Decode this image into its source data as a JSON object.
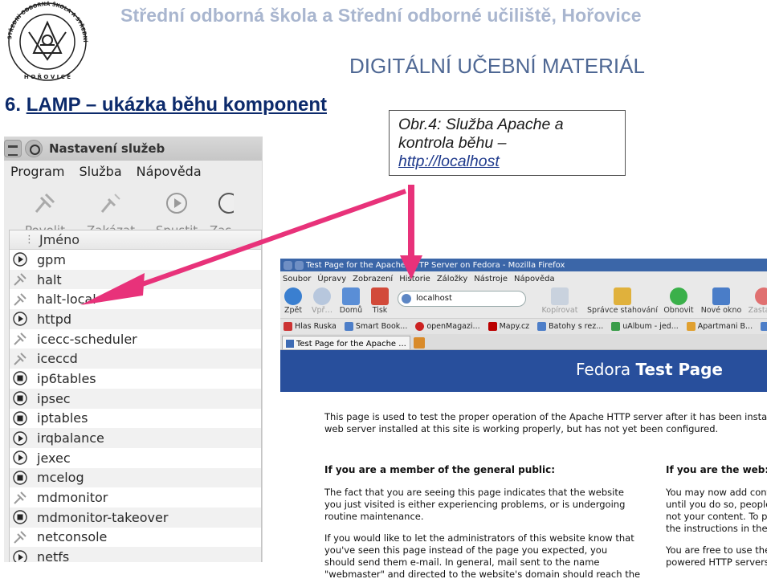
{
  "header": {
    "school_name": "Střední odborná škola a Střední odborné učiliště, Hořovice",
    "material_title": "DIGITÁLNÍ UČEBNÍ MATERIÁL",
    "logo_ring_text": "STŘEDNÍ ODBORNÁ ŠKOLA A STŘEDNÍ ODBORNÉ UČILIŠTĚ",
    "logo_city": "H O Ř O V I C E"
  },
  "slide": {
    "number": "6.",
    "title": "LAMP – ukázka běhu komponent"
  },
  "caption": {
    "line1": "Obr.4: Služba Apache a",
    "line2": "kontrola běhu –",
    "url": "http://localhost"
  },
  "service_manager": {
    "window_title": "Nastavení služeb",
    "menu": [
      "Program",
      "Služba",
      "Nápověda"
    ],
    "toolbar": [
      "Povolit",
      "Zakázat",
      "Spustit",
      "Zas"
    ],
    "column_header": "Jméno",
    "services": [
      {
        "name": "gpm",
        "state": "run"
      },
      {
        "name": "halt",
        "state": "off"
      },
      {
        "name": "halt-local",
        "state": "off"
      },
      {
        "name": "httpd",
        "state": "run"
      },
      {
        "name": "icecc-scheduler",
        "state": "off"
      },
      {
        "name": "iceccd",
        "state": "off"
      },
      {
        "name": "ip6tables",
        "state": "stop"
      },
      {
        "name": "ipsec",
        "state": "stop"
      },
      {
        "name": "iptables",
        "state": "stop"
      },
      {
        "name": "irqbalance",
        "state": "run"
      },
      {
        "name": "jexec",
        "state": "run"
      },
      {
        "name": "mcelog",
        "state": "stop"
      },
      {
        "name": "mdmonitor",
        "state": "off"
      },
      {
        "name": "mdmonitor-takeover",
        "state": "stop"
      },
      {
        "name": "netconsole",
        "state": "off"
      },
      {
        "name": "netfs",
        "state": "run"
      }
    ]
  },
  "firefox": {
    "window_title": "Test Page for the Apache HTTP Server on Fedora - Mozilla Firefox",
    "menu": [
      "Soubor",
      "Úpravy",
      "Zobrazení",
      "Historie",
      "Záložky",
      "Nástroje",
      "Nápověda"
    ],
    "nav_left": [
      "Zpět",
      "Vpř…",
      "Domů",
      "Tisk"
    ],
    "url": "localhost",
    "nav_right": [
      "Kopírovat",
      "Správce stahování",
      "Obnovit",
      "Nové okno",
      "Zastavit"
    ],
    "bookmarks": [
      "Hlas Ruska",
      "Smart Book...",
      "openMagazi...",
      "Mapy.cz",
      "Batohy s rez...",
      "uAlbum - jed...",
      "Apartmani B...",
      "C"
    ],
    "tab_label": "Test Page for the Apache ...",
    "banner_normal": "Fedora",
    "banner_bold": "Test Page",
    "intro_lines": [
      "This page is used to test the proper operation of the Apache HTTP server after it has been installed",
      "web server installed at this site is working properly, but has not yet been configured."
    ],
    "left_col": {
      "title": "If you are a member of the general public:",
      "lines": [
        "The fact that you are seeing this page indicates that the website",
        "you just visited is either experiencing problems, or is undergoing",
        "routine maintenance.",
        "",
        "If you would like to let the administrators of this website know that",
        "you've seen this page instead of the page you expected, you",
        "should send them e-mail. In general, mail sent to the name",
        "\"webmaster\" and directed to the website's domain should reach the"
      ]
    },
    "right_col": {
      "title": "If you are the web:",
      "lines": [
        "You may now add cont",
        "until you do so, people",
        "not your content. To pr",
        "the instructions in the",
        "",
        "You are free to use the",
        "powered HTTP servers"
      ]
    }
  },
  "colors": {
    "school_name": "#a9b6cf",
    "material_title": "#4f6894",
    "slide_title": "#0c2a6b",
    "arrow": "#e8327a",
    "fedora_banner": "#284f9c"
  }
}
